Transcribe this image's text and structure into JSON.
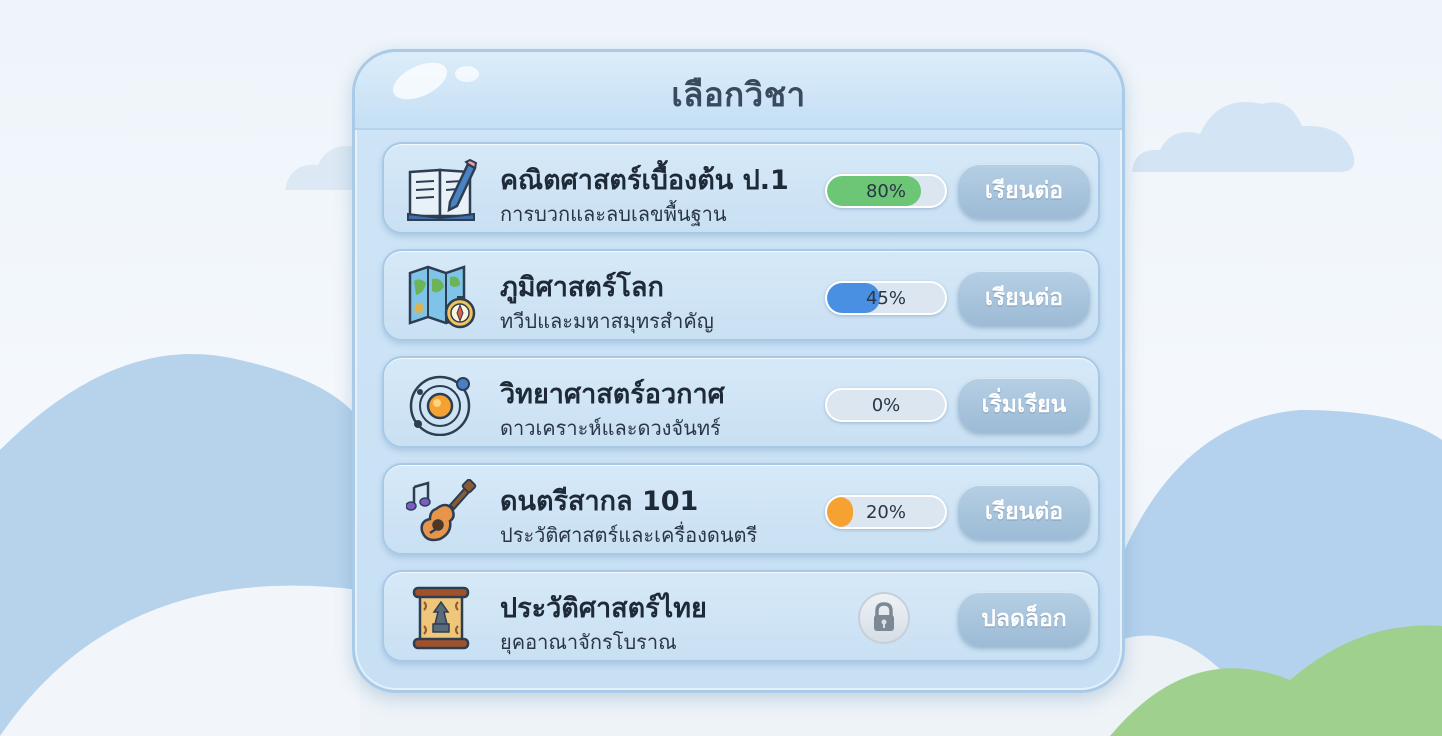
{
  "panel": {
    "title": "เลือกวิชา"
  },
  "courses": [
    {
      "title": "คณิตศาสตร์เบื้องต้น ป.1",
      "subtitle": "การบวกและลบเลขพื้นฐาน",
      "progress_text": "80%",
      "progress": 0.8,
      "bar_color": "#6cc676",
      "button": "เรียนต่อ",
      "icon": "book-pencil-icon"
    },
    {
      "title": "ภูมิศาสตร์โลก",
      "subtitle": "ทวีปและมหาสมุทรสำคัญ",
      "progress_text": "45%",
      "progress": 0.45,
      "bar_color": "#4a90e2",
      "button": "เรียนต่อ",
      "icon": "map-compass-icon"
    },
    {
      "title": "วิทยาศาสตร์อวกาศ",
      "subtitle": "ดาวเคราะห์และดวงจันทร์",
      "progress_text": "0%",
      "progress": 0,
      "bar_color": "#dbe6f1",
      "button": "เริ่มเรียน",
      "icon": "solar-system-icon"
    },
    {
      "title": "ดนตรีสากล 101",
      "subtitle": "ประวัติศาสตร์และเครื่องดนตรี",
      "progress_text": "20%",
      "progress": 0.2,
      "bar_color": "#f5a233",
      "button": "เรียนต่อ",
      "icon": "guitar-music-icon"
    },
    {
      "title": "ประวัติศาสตร์ไทย",
      "subtitle": "ยุคอาณาจักรโบราณ",
      "locked": true,
      "button": "ปลดล็อก",
      "icon": "ancient-scroll-icon"
    }
  ]
}
